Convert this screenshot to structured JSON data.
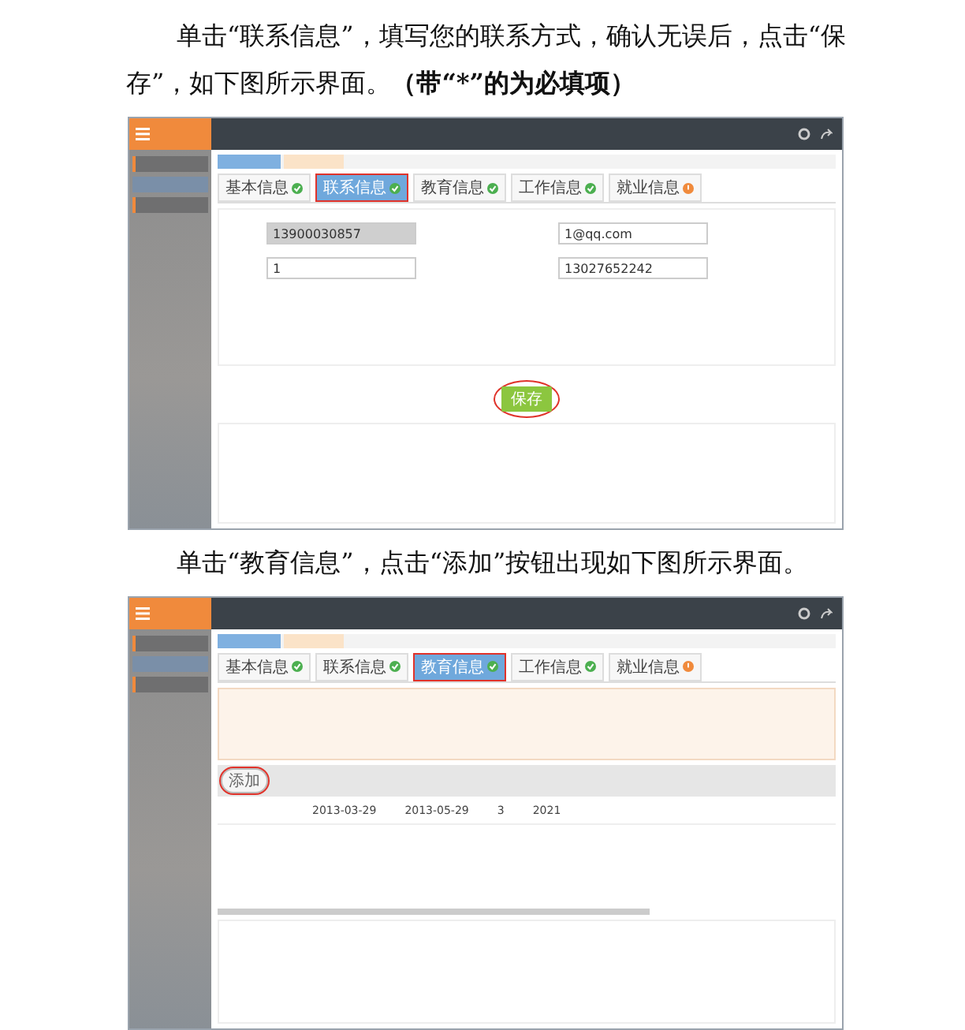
{
  "sections": [
    {
      "instruction": "单击“联系信息”，填写您的联系方式，确认无误后，点击“保存”，如下图所示界面。**（带“*”的为必填项）**",
      "screen": {
        "kind": "contact",
        "info_tabs": [
          {
            "label": "基本信息",
            "kind": "done",
            "selected": false,
            "highlighted": false
          },
          {
            "label": "联系信息",
            "kind": "done",
            "selected": true,
            "highlighted": true
          },
          {
            "label": "教育信息",
            "kind": "done",
            "selected": false,
            "highlighted": false
          },
          {
            "label": "工作信息",
            "kind": "done",
            "selected": false,
            "highlighted": false
          },
          {
            "label": "就业信息",
            "kind": "warning",
            "selected": false,
            "highlighted": false
          }
        ],
        "fields": [
          {
            "value": "13900030857",
            "disabled": true
          },
          {
            "value": "1@qq.com",
            "disabled": false
          },
          {
            "value": "1",
            "disabled": false
          },
          {
            "value": "13027652242",
            "disabled": false
          }
        ],
        "save_button": {
          "label": "保存",
          "circled": true
        }
      }
    },
    {
      "instruction": "单击“教育信息”，点击“添加”按钮出现如下图所示界面。",
      "screen": {
        "kind": "education",
        "info_tabs": [
          {
            "label": "基本信息",
            "kind": "done",
            "selected": false,
            "highlighted": false
          },
          {
            "label": "联系信息",
            "kind": "done",
            "selected": false,
            "highlighted": false
          },
          {
            "label": "教育信息",
            "kind": "done",
            "selected": true,
            "highlighted": true
          },
          {
            "label": "工作信息",
            "kind": "done",
            "selected": false,
            "highlighted": false
          },
          {
            "label": "就业信息",
            "kind": "warning",
            "selected": false,
            "highlighted": false
          }
        ],
        "add_button": {
          "label": "添加",
          "circled": true
        },
        "row": [
          "2013-03-29",
          "2013-05-29",
          "3",
          "2021"
        ]
      }
    }
  ]
}
